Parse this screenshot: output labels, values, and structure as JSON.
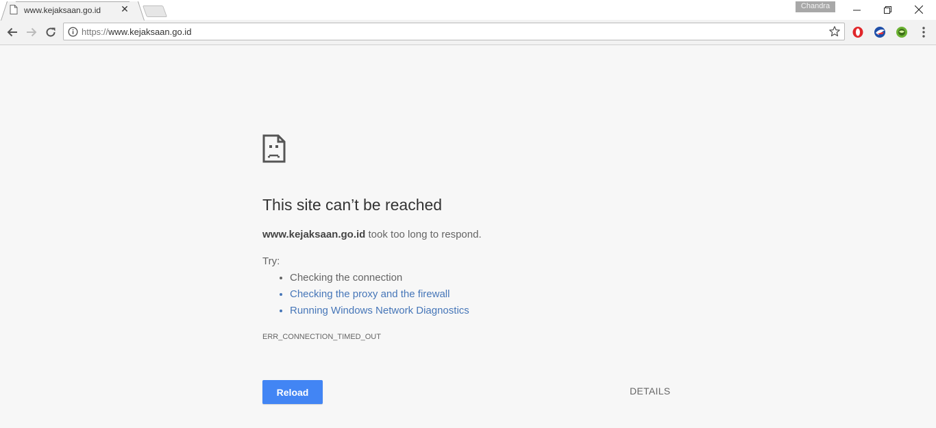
{
  "browser": {
    "tab": {
      "title": "www.kejaksaan.go.id",
      "close_glyph": "✕"
    },
    "profile_name": "Chandra",
    "omnibox": {
      "scheme": "https://",
      "host": "www.kejaksaan.go.id"
    }
  },
  "error_page": {
    "heading": "This site can’t be reached",
    "host": "www.kejaksaan.go.id",
    "message": " took too long to respond.",
    "try_label": "Try:",
    "suggestions": [
      "Checking the connection",
      "Checking the proxy and the firewall",
      "Running Windows Network Diagnostics"
    ],
    "error_code": "ERR_CONNECTION_TIMED_OUT",
    "reload_label": "Reload",
    "details_label": "DETAILS"
  },
  "colors": {
    "page_background": "#f7f7f7",
    "reload_button": "#4285f4",
    "link": "#4676b8",
    "text": "#646464"
  },
  "icons": {
    "tab": [
      "document-icon",
      "close-icon",
      "new-tab-icon"
    ],
    "window": [
      "minimize-icon",
      "restore-icon",
      "close-window-icon"
    ],
    "toolbar": [
      "back-arrow-icon",
      "forward-arrow-icon",
      "reload-icon",
      "info-icon",
      "star-icon",
      "opera-extension-icon",
      "blue-bird-extension-icon",
      "green-extension-icon",
      "menu-dots-icon"
    ],
    "content": [
      "sad-page-icon"
    ]
  }
}
